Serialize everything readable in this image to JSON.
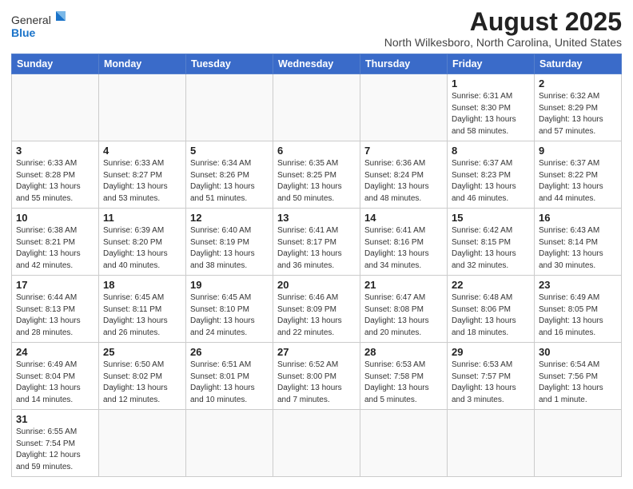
{
  "logo": {
    "general": "General",
    "blue": "Blue"
  },
  "title": "August 2025",
  "subtitle": "North Wilkesboro, North Carolina, United States",
  "weekdays": [
    "Sunday",
    "Monday",
    "Tuesday",
    "Wednesday",
    "Thursday",
    "Friday",
    "Saturday"
  ],
  "weeks": [
    [
      {
        "day": "",
        "info": ""
      },
      {
        "day": "",
        "info": ""
      },
      {
        "day": "",
        "info": ""
      },
      {
        "day": "",
        "info": ""
      },
      {
        "day": "",
        "info": ""
      },
      {
        "day": "1",
        "info": "Sunrise: 6:31 AM\nSunset: 8:30 PM\nDaylight: 13 hours and 58 minutes."
      },
      {
        "day": "2",
        "info": "Sunrise: 6:32 AM\nSunset: 8:29 PM\nDaylight: 13 hours and 57 minutes."
      }
    ],
    [
      {
        "day": "3",
        "info": "Sunrise: 6:33 AM\nSunset: 8:28 PM\nDaylight: 13 hours and 55 minutes."
      },
      {
        "day": "4",
        "info": "Sunrise: 6:33 AM\nSunset: 8:27 PM\nDaylight: 13 hours and 53 minutes."
      },
      {
        "day": "5",
        "info": "Sunrise: 6:34 AM\nSunset: 8:26 PM\nDaylight: 13 hours and 51 minutes."
      },
      {
        "day": "6",
        "info": "Sunrise: 6:35 AM\nSunset: 8:25 PM\nDaylight: 13 hours and 50 minutes."
      },
      {
        "day": "7",
        "info": "Sunrise: 6:36 AM\nSunset: 8:24 PM\nDaylight: 13 hours and 48 minutes."
      },
      {
        "day": "8",
        "info": "Sunrise: 6:37 AM\nSunset: 8:23 PM\nDaylight: 13 hours and 46 minutes."
      },
      {
        "day": "9",
        "info": "Sunrise: 6:37 AM\nSunset: 8:22 PM\nDaylight: 13 hours and 44 minutes."
      }
    ],
    [
      {
        "day": "10",
        "info": "Sunrise: 6:38 AM\nSunset: 8:21 PM\nDaylight: 13 hours and 42 minutes."
      },
      {
        "day": "11",
        "info": "Sunrise: 6:39 AM\nSunset: 8:20 PM\nDaylight: 13 hours and 40 minutes."
      },
      {
        "day": "12",
        "info": "Sunrise: 6:40 AM\nSunset: 8:19 PM\nDaylight: 13 hours and 38 minutes."
      },
      {
        "day": "13",
        "info": "Sunrise: 6:41 AM\nSunset: 8:17 PM\nDaylight: 13 hours and 36 minutes."
      },
      {
        "day": "14",
        "info": "Sunrise: 6:41 AM\nSunset: 8:16 PM\nDaylight: 13 hours and 34 minutes."
      },
      {
        "day": "15",
        "info": "Sunrise: 6:42 AM\nSunset: 8:15 PM\nDaylight: 13 hours and 32 minutes."
      },
      {
        "day": "16",
        "info": "Sunrise: 6:43 AM\nSunset: 8:14 PM\nDaylight: 13 hours and 30 minutes."
      }
    ],
    [
      {
        "day": "17",
        "info": "Sunrise: 6:44 AM\nSunset: 8:13 PM\nDaylight: 13 hours and 28 minutes."
      },
      {
        "day": "18",
        "info": "Sunrise: 6:45 AM\nSunset: 8:11 PM\nDaylight: 13 hours and 26 minutes."
      },
      {
        "day": "19",
        "info": "Sunrise: 6:45 AM\nSunset: 8:10 PM\nDaylight: 13 hours and 24 minutes."
      },
      {
        "day": "20",
        "info": "Sunrise: 6:46 AM\nSunset: 8:09 PM\nDaylight: 13 hours and 22 minutes."
      },
      {
        "day": "21",
        "info": "Sunrise: 6:47 AM\nSunset: 8:08 PM\nDaylight: 13 hours and 20 minutes."
      },
      {
        "day": "22",
        "info": "Sunrise: 6:48 AM\nSunset: 8:06 PM\nDaylight: 13 hours and 18 minutes."
      },
      {
        "day": "23",
        "info": "Sunrise: 6:49 AM\nSunset: 8:05 PM\nDaylight: 13 hours and 16 minutes."
      }
    ],
    [
      {
        "day": "24",
        "info": "Sunrise: 6:49 AM\nSunset: 8:04 PM\nDaylight: 13 hours and 14 minutes."
      },
      {
        "day": "25",
        "info": "Sunrise: 6:50 AM\nSunset: 8:02 PM\nDaylight: 13 hours and 12 minutes."
      },
      {
        "day": "26",
        "info": "Sunrise: 6:51 AM\nSunset: 8:01 PM\nDaylight: 13 hours and 10 minutes."
      },
      {
        "day": "27",
        "info": "Sunrise: 6:52 AM\nSunset: 8:00 PM\nDaylight: 13 hours and 7 minutes."
      },
      {
        "day": "28",
        "info": "Sunrise: 6:53 AM\nSunset: 7:58 PM\nDaylight: 13 hours and 5 minutes."
      },
      {
        "day": "29",
        "info": "Sunrise: 6:53 AM\nSunset: 7:57 PM\nDaylight: 13 hours and 3 minutes."
      },
      {
        "day": "30",
        "info": "Sunrise: 6:54 AM\nSunset: 7:56 PM\nDaylight: 13 hours and 1 minute."
      }
    ],
    [
      {
        "day": "31",
        "info": "Sunrise: 6:55 AM\nSunset: 7:54 PM\nDaylight: 12 hours and 59 minutes."
      },
      {
        "day": "",
        "info": ""
      },
      {
        "day": "",
        "info": ""
      },
      {
        "day": "",
        "info": ""
      },
      {
        "day": "",
        "info": ""
      },
      {
        "day": "",
        "info": ""
      },
      {
        "day": "",
        "info": ""
      }
    ]
  ]
}
